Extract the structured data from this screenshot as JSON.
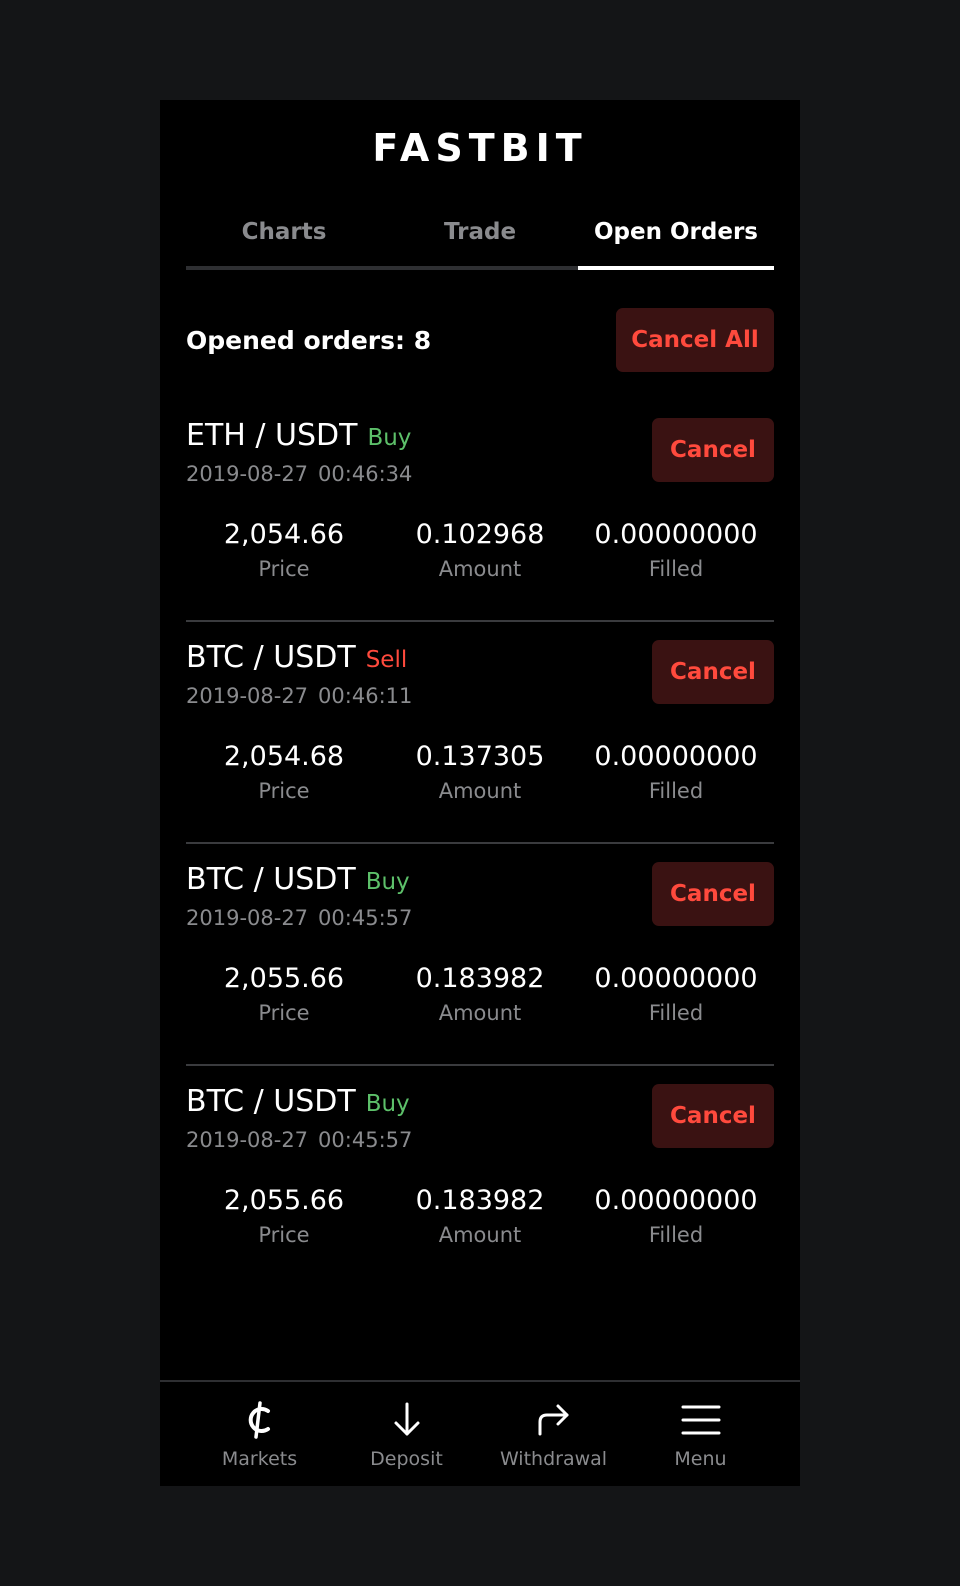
{
  "app": {
    "logo": "FASTBIT"
  },
  "tabs": [
    {
      "label": "Charts"
    },
    {
      "label": "Trade"
    },
    {
      "label": "Open Orders",
      "active": true
    }
  ],
  "summary": {
    "label": "Opened orders: 8",
    "cancel_all_label": "Cancel All"
  },
  "labels": {
    "price": "Price",
    "amount": "Amount",
    "filled": "Filled",
    "cancel": "Cancel"
  },
  "orders": [
    {
      "pair": "ETH / USDT",
      "side": "Buy",
      "date": "2019-08-27",
      "time": "00:46:34",
      "price": "2,054.66",
      "amount": "0.102968",
      "filled": "0.00000000"
    },
    {
      "pair": "BTC / USDT",
      "side": "Sell",
      "date": "2019-08-27",
      "time": "00:46:11",
      "price": "2,054.68",
      "amount": "0.137305",
      "filled": "0.00000000"
    },
    {
      "pair": "BTC / USDT",
      "side": "Buy",
      "date": "2019-08-27",
      "time": "00:45:57",
      "price": "2,055.66",
      "amount": "0.183982",
      "filled": "0.00000000"
    },
    {
      "pair": "BTC / USDT",
      "side": "Buy",
      "date": "2019-08-27",
      "time": "00:45:57",
      "price": "2,055.66",
      "amount": "0.183982",
      "filled": "0.00000000"
    }
  ],
  "bottom_nav": [
    {
      "label": "Markets",
      "icon": "cedi-icon"
    },
    {
      "label": "Deposit",
      "icon": "arrow-down-icon"
    },
    {
      "label": "Withdrawal",
      "icon": "forward-arrow-icon"
    },
    {
      "label": "Menu",
      "icon": "menu-icon"
    }
  ],
  "colors": {
    "buy": "#5dc06a",
    "sell": "#ff4a3d",
    "cancel_bg": "#3a1212"
  }
}
